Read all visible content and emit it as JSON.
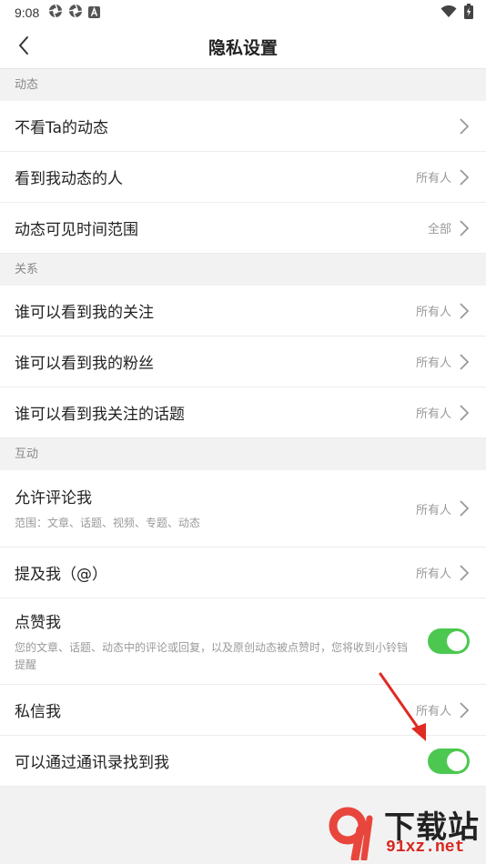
{
  "status_bar": {
    "time": "9:08",
    "left_icons": [
      "aperture-icon",
      "aperture-icon",
      "a-badge-icon"
    ],
    "right_icons": [
      "wifi-icon",
      "battery-charging-icon"
    ]
  },
  "header": {
    "title": "隐私设置",
    "back_icon": "back-arrow-icon"
  },
  "sections": [
    {
      "title": "动态",
      "items": [
        {
          "label": "不看Ta的动态",
          "value": "",
          "type": "nav"
        },
        {
          "label": "看到我动态的人",
          "value": "所有人",
          "type": "nav"
        },
        {
          "label": "动态可见时间范围",
          "value": "全部",
          "type": "nav"
        }
      ]
    },
    {
      "title": "关系",
      "items": [
        {
          "label": "谁可以看到我的关注",
          "value": "所有人",
          "type": "nav"
        },
        {
          "label": "谁可以看到我的粉丝",
          "value": "所有人",
          "type": "nav"
        },
        {
          "label": "谁可以看到我关注的话题",
          "value": "所有人",
          "type": "nav"
        }
      ]
    },
    {
      "title": "互动",
      "items": [
        {
          "label": "允许评论我",
          "desc": "范围：文章、话题、视频、专题、动态",
          "value": "所有人",
          "type": "nav"
        },
        {
          "label": "提及我（@）",
          "value": "所有人",
          "type": "nav"
        },
        {
          "label": "点赞我",
          "desc": "您的文章、话题、动态中的评论或回复，以及原创动态被点赞时，您将收到小铃铛提醒",
          "type": "toggle",
          "on": true
        },
        {
          "label": "私信我",
          "value": "所有人",
          "type": "nav"
        },
        {
          "label": "可以通过通讯录找到我",
          "type": "toggle",
          "on": true
        }
      ]
    }
  ],
  "colors": {
    "toggle_on": "#4cc851",
    "annotation_arrow": "#e02a22",
    "background": "#f2f2f2"
  },
  "watermark": {
    "text": "下载站",
    "url": "91xz.net",
    "logo": "91-logo"
  }
}
